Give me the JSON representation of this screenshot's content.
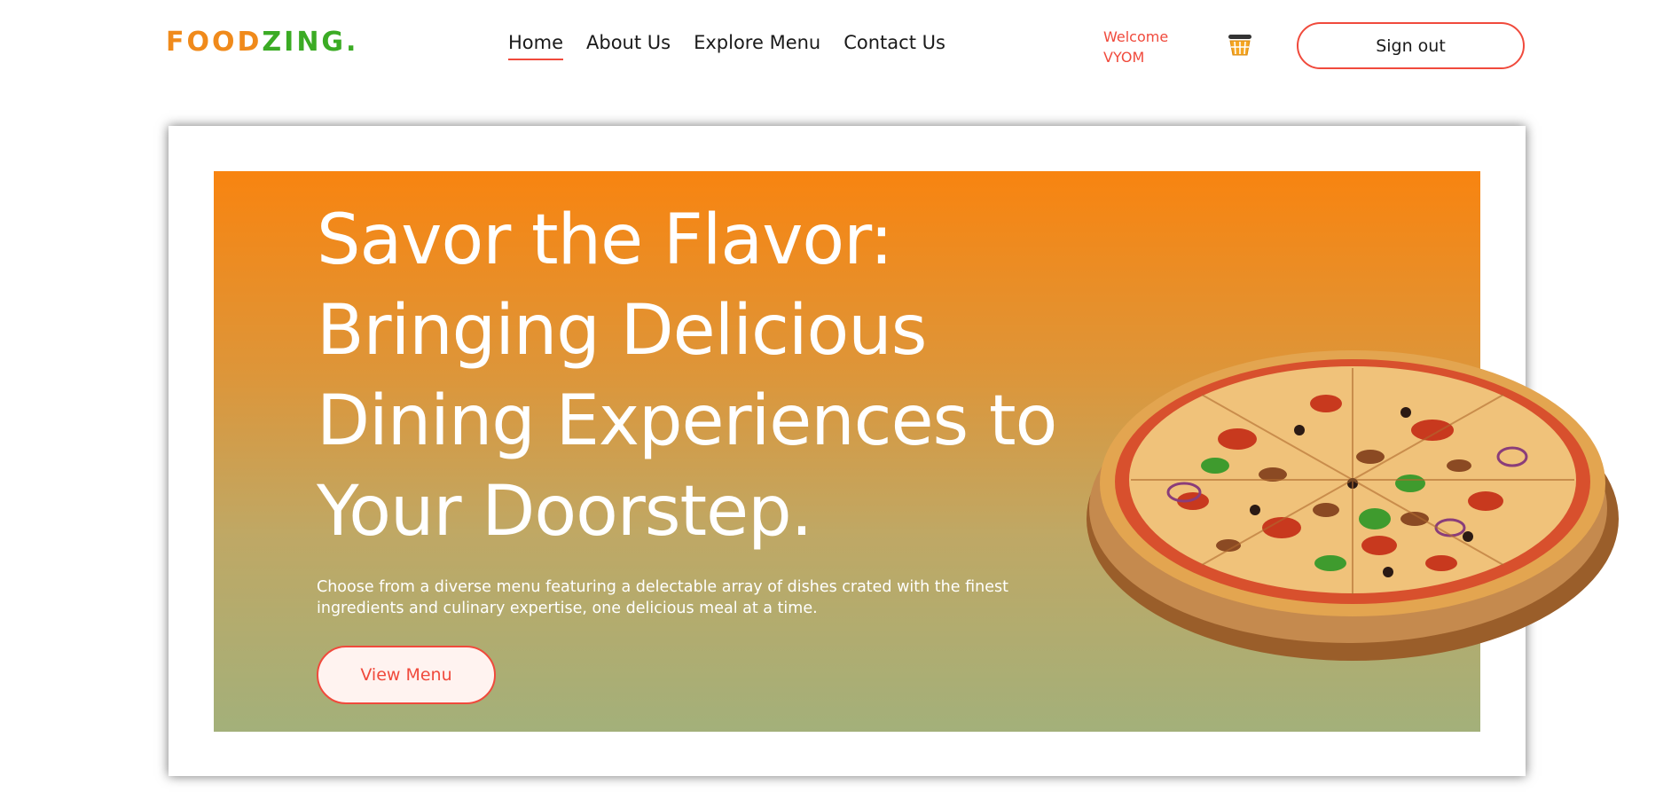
{
  "brand": {
    "logo_part1": "FOOD",
    "logo_part2": "ZING."
  },
  "nav": {
    "items": [
      {
        "label": "Home",
        "active": true
      },
      {
        "label": "About Us",
        "active": false
      },
      {
        "label": "Explore Menu",
        "active": false
      },
      {
        "label": "Contact Us",
        "active": false
      }
    ]
  },
  "user": {
    "welcome_label": "Welcome",
    "username": "VYOM"
  },
  "header": {
    "signout_label": "Sign out",
    "cart_icon": "basket-icon"
  },
  "hero": {
    "title": "Savor the Flavor: Bringing Delicious Dining Experiences to Your Doorstep.",
    "description": "Choose from a diverse menu featuring a delectable array of dishes crated with the finest ingredients and culinary expertise, one delicious meal at a time.",
    "cta_label": "View Menu",
    "image": "pizza-image"
  },
  "colors": {
    "accent": "#f04a3c",
    "logo_orange": "#f08a1b",
    "logo_green": "#3bab24",
    "hero_gradient_top": "#f88410",
    "hero_gradient_bottom": "#a3b07a"
  }
}
